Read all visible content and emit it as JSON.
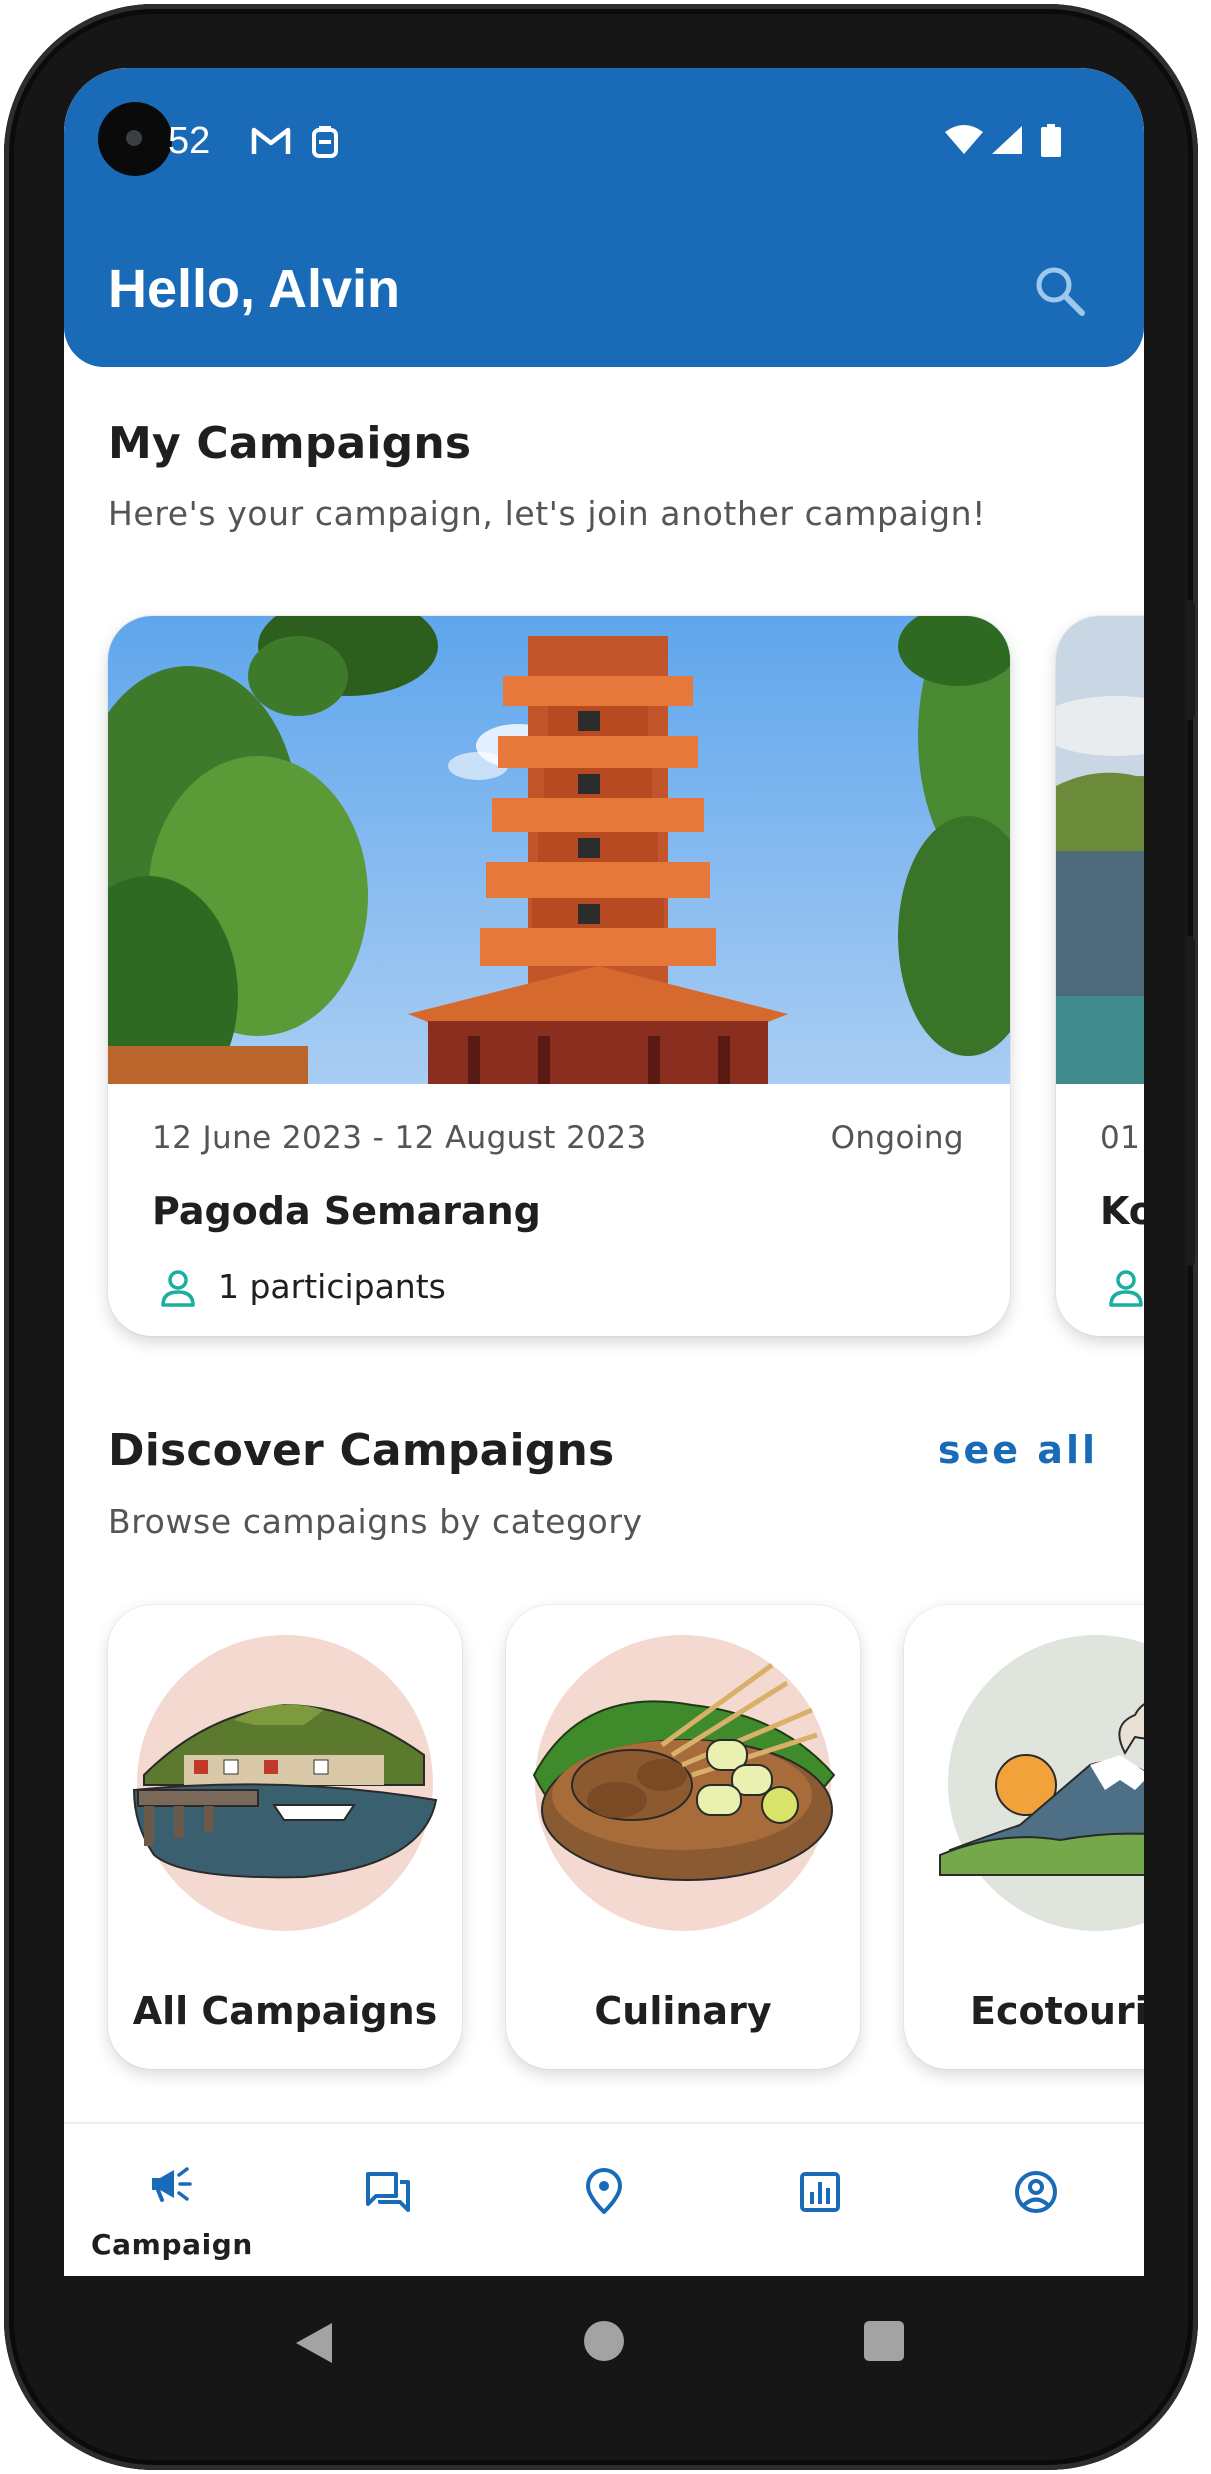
{
  "status_bar": {
    "time": "52"
  },
  "header": {
    "greeting": "Hello, Alvin"
  },
  "my_campaigns": {
    "title": "My Campaigns",
    "subtitle": "Here's your campaign, let's join another campaign!",
    "cards": [
      {
        "date_range": "12 June 2023 - 12 August 2023",
        "status": "Ongoing",
        "name": "Pagoda Semarang",
        "participants": "1 participants"
      },
      {
        "date_range": "01",
        "status": "",
        "name": "Ko",
        "participants": ""
      }
    ]
  },
  "discover": {
    "title": "Discover Campaigns",
    "subtitle": "Browse campaigns by category",
    "see_all": "see all",
    "categories": [
      {
        "label": "All Campaigns"
      },
      {
        "label": "Culinary"
      },
      {
        "label": "Ecotouris"
      }
    ]
  },
  "bottom_nav": {
    "items": [
      {
        "label": "Campaign",
        "icon": "megaphone-icon",
        "active": true
      },
      {
        "label": "",
        "icon": "forum-icon"
      },
      {
        "label": "",
        "icon": "location-pin-icon"
      },
      {
        "label": "",
        "icon": "bar-chart-icon"
      },
      {
        "label": "",
        "icon": "account-icon"
      }
    ]
  },
  "colors": {
    "primary": "#1a6bb7",
    "accent_teal": "#1aae9f",
    "text_dark": "#1f1f1f",
    "text_muted": "#555555"
  }
}
